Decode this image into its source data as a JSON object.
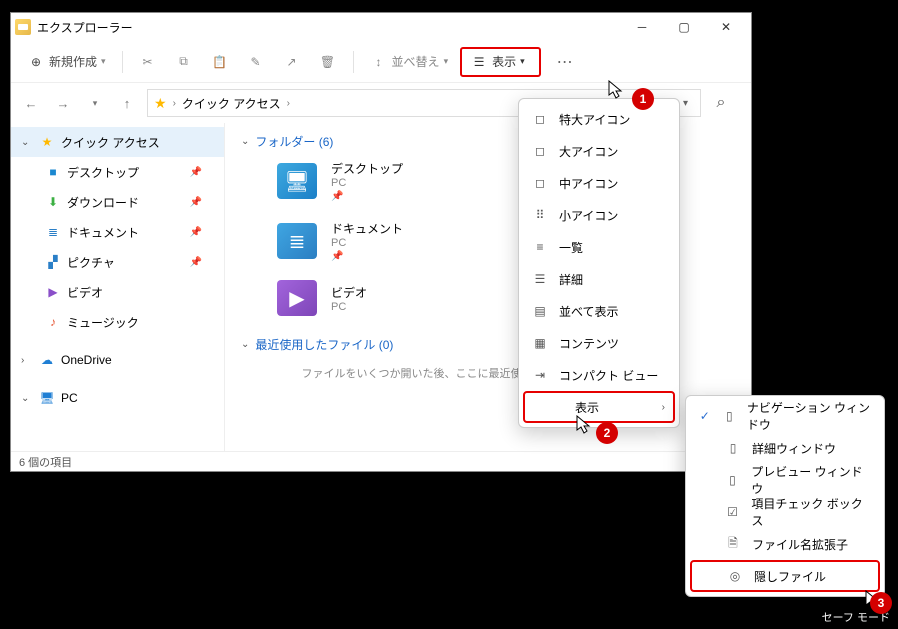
{
  "window": {
    "title": "エクスプローラー"
  },
  "toolbar": {
    "new": "新規作成",
    "sort": "並べ替え",
    "view": "表示"
  },
  "address": {
    "root": "クイック アクセス"
  },
  "sidebar": {
    "quick": "クイック アクセス",
    "items": [
      {
        "label": "デスクトップ"
      },
      {
        "label": "ダウンロード"
      },
      {
        "label": "ドキュメント"
      },
      {
        "label": "ピクチャ"
      },
      {
        "label": "ビデオ"
      },
      {
        "label": "ミュージック"
      }
    ],
    "onedrive": "OneDrive",
    "pc": "PC"
  },
  "main": {
    "folders_head": "フォルダー  (6)",
    "recent_head": "最近使用したファイル  (0)",
    "folders": [
      {
        "name": "デスクトップ",
        "sub": "PC"
      },
      {
        "name": "ドキュメント",
        "sub": "PC"
      },
      {
        "name": "ビデオ",
        "sub": "PC"
      }
    ],
    "empty": "ファイルをいくつか開いた後、ここに最近使ったファイルが表示されます。"
  },
  "status": {
    "count": "6 個の項目"
  },
  "dropdown1": {
    "items": [
      "特大アイコン",
      "大アイコン",
      "中アイコン",
      "小アイコン",
      "一覧",
      "詳細",
      "並べて表示",
      "コンテンツ",
      "コンパクト ビュー",
      "表示"
    ]
  },
  "dropdown2": {
    "items": [
      "ナビゲーション ウィンドウ",
      "詳細ウィンドウ",
      "プレビュー ウィンドウ",
      "項目チェック ボックス",
      "ファイル名拡張子",
      "隠しファイル"
    ]
  },
  "badges": {
    "b1": "1",
    "b2": "2",
    "b3": "3"
  },
  "footer": {
    "safe_mode": "セーフ モード"
  }
}
